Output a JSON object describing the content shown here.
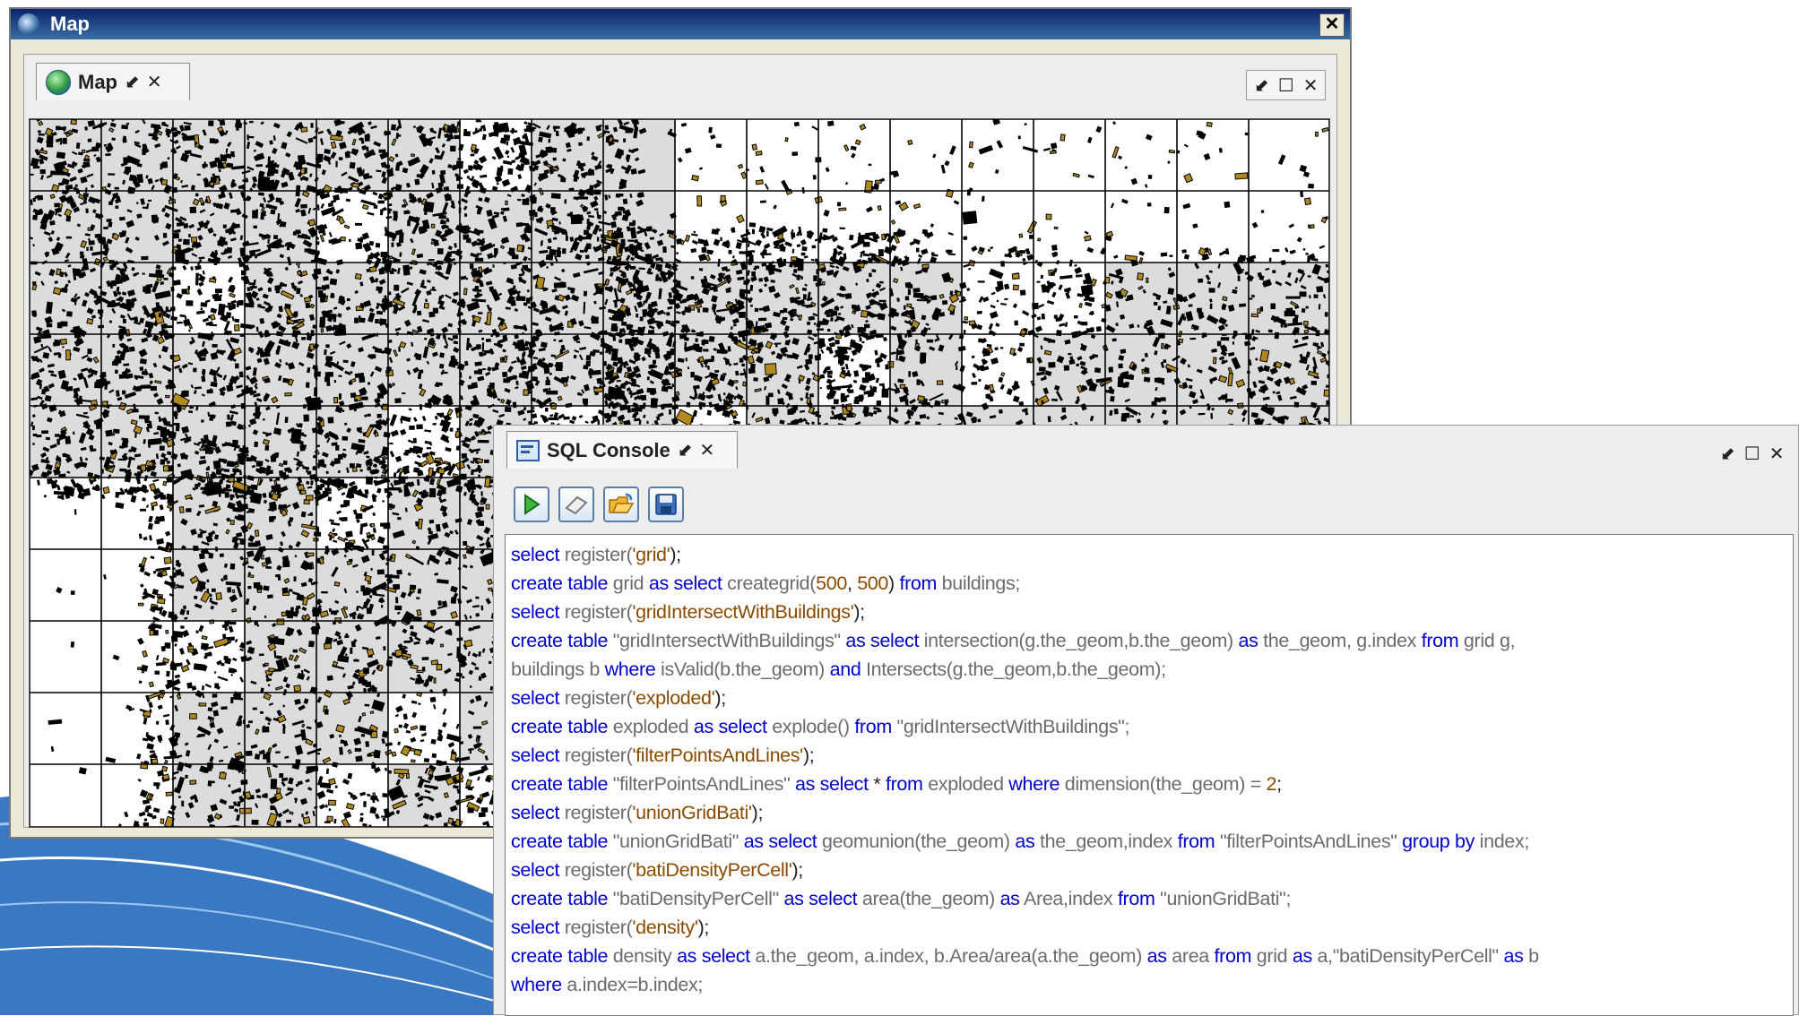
{
  "map_window": {
    "title": "Map",
    "close_glyph": "✕",
    "tab_label": "Map",
    "pin_glyph": "⬋",
    "tab_close_glyph": "✕",
    "panel_controls": [
      "⬋",
      "☐",
      "✕"
    ]
  },
  "map": {
    "building_color": "#b08a1e",
    "shade_color": "#dcdcdc",
    "grid_color": "#000000"
  },
  "sql_console": {
    "tab_label": "SQL Console",
    "pin_glyph": "⬋",
    "tab_close_glyph": "✕",
    "panel_controls": [
      "⬋",
      "☐",
      "✕"
    ],
    "toolbar": [
      {
        "name": "execute-icon"
      },
      {
        "name": "clear-icon"
      },
      {
        "name": "open-folder-icon"
      },
      {
        "name": "save-icon"
      }
    ],
    "code_lines": [
      [
        [
          "kw",
          "select"
        ],
        [
          "fn",
          " register("
        ],
        [
          "str",
          "'grid'"
        ],
        [
          "plain",
          ");"
        ]
      ],
      [
        [
          "kw",
          "create table"
        ],
        [
          "fn",
          " grid "
        ],
        [
          "kw",
          "as select"
        ],
        [
          "fn",
          " creategrid("
        ],
        [
          "num",
          "500"
        ],
        [
          "plain",
          ", "
        ],
        [
          "num",
          "500"
        ],
        [
          "plain",
          ") "
        ],
        [
          "kw",
          "from"
        ],
        [
          "fn",
          " buildings;"
        ]
      ],
      [
        [
          "kw",
          "select"
        ],
        [
          "fn",
          " register("
        ],
        [
          "str",
          "'gridIntersectWithBuildings'"
        ],
        [
          "plain",
          ");"
        ]
      ],
      [
        [
          "kw",
          "create table"
        ],
        [
          "fn",
          " \"gridIntersectWithBuildings\" "
        ],
        [
          "kw",
          "as select"
        ],
        [
          "fn",
          " intersection(g.the_geom,b.the_geom) "
        ],
        [
          "kw",
          "as"
        ],
        [
          "fn",
          " the_geom, g.index "
        ],
        [
          "kw",
          "from"
        ],
        [
          "fn",
          " grid g,"
        ]
      ],
      [
        [
          "fn",
          "buildings b "
        ],
        [
          "kw",
          "where"
        ],
        [
          "fn",
          " isValid(b.the_geom) "
        ],
        [
          "kw",
          "and"
        ],
        [
          "fn",
          " Intersects(g.the_geom,b.the_geom);"
        ]
      ],
      [
        [
          "kw",
          "select"
        ],
        [
          "fn",
          " register("
        ],
        [
          "str",
          "'exploded'"
        ],
        [
          "plain",
          ");"
        ]
      ],
      [
        [
          "kw",
          "create table"
        ],
        [
          "fn",
          " exploded "
        ],
        [
          "kw",
          "as select"
        ],
        [
          "fn",
          " explode() "
        ],
        [
          "kw",
          "from"
        ],
        [
          "fn",
          " \"gridIntersectWithBuildings\";"
        ]
      ],
      [
        [
          "kw",
          "select"
        ],
        [
          "fn",
          " register("
        ],
        [
          "str",
          "'filterPointsAndLines'"
        ],
        [
          "plain",
          ");"
        ]
      ],
      [
        [
          "kw",
          "create table"
        ],
        [
          "fn",
          " \"filterPointsAndLines\" "
        ],
        [
          "kw",
          "as select"
        ],
        [
          "plain",
          " * "
        ],
        [
          "kw",
          "from"
        ],
        [
          "fn",
          " exploded "
        ],
        [
          "kw",
          "where"
        ],
        [
          "fn",
          " dimension(the_geom) = "
        ],
        [
          "num",
          "2"
        ],
        [
          "plain",
          ";"
        ]
      ],
      [
        [
          "kw",
          "select"
        ],
        [
          "fn",
          " register("
        ],
        [
          "str",
          "'unionGridBati'"
        ],
        [
          "plain",
          ");"
        ]
      ],
      [
        [
          "kw",
          "create table"
        ],
        [
          "fn",
          " \"unionGridBati\" "
        ],
        [
          "kw",
          "as select"
        ],
        [
          "fn",
          " geomunion(the_geom) "
        ],
        [
          "kw",
          "as"
        ],
        [
          "fn",
          " the_geom,index "
        ],
        [
          "kw",
          "from"
        ],
        [
          "fn",
          " \"filterPointsAndLines\" "
        ],
        [
          "kw",
          "group by"
        ],
        [
          "fn",
          " index;"
        ]
      ],
      [
        [
          "kw",
          "select"
        ],
        [
          "fn",
          " register("
        ],
        [
          "str",
          "'batiDensityPerCell'"
        ],
        [
          "plain",
          ");"
        ]
      ],
      [
        [
          "kw",
          "create table"
        ],
        [
          "fn",
          " \"batiDensityPerCell\" "
        ],
        [
          "kw",
          "as select"
        ],
        [
          "fn",
          " area(the_geom) "
        ],
        [
          "kw",
          "as"
        ],
        [
          "fn",
          " Area,index "
        ],
        [
          "kw",
          "from"
        ],
        [
          "fn",
          " \"unionGridBati\";"
        ]
      ],
      [
        [
          "kw",
          "select"
        ],
        [
          "fn",
          " register("
        ],
        [
          "str",
          "'density'"
        ],
        [
          "plain",
          ");"
        ]
      ],
      [
        [
          "kw",
          "create table"
        ],
        [
          "fn",
          " density "
        ],
        [
          "kw",
          "as select"
        ],
        [
          "fn",
          " a.the_geom, a.index, b.Area/area(a.the_geom) "
        ],
        [
          "kw",
          "as"
        ],
        [
          "fn",
          " area "
        ],
        [
          "kw",
          "from"
        ],
        [
          "fn",
          " grid "
        ],
        [
          "kw",
          "as"
        ],
        [
          "fn",
          " a,\"batiDensityPerCell\" "
        ],
        [
          "kw",
          "as"
        ],
        [
          "fn",
          " b"
        ]
      ],
      [
        [
          "kw",
          "where"
        ],
        [
          "fn",
          " a.index=b.index;"
        ]
      ]
    ]
  }
}
